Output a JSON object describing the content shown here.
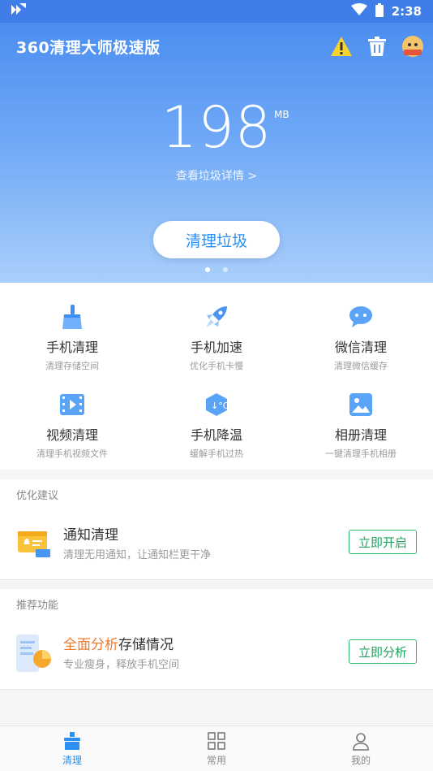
{
  "status": {
    "time": "2:38"
  },
  "header": {
    "title": "360清理大师极速版"
  },
  "hero": {
    "amount": "198",
    "unit": "MB",
    "detail_link": "查看垃圾详情 >",
    "clean_button": "清理垃圾",
    "page_dots": 2,
    "active_dot": 1
  },
  "grid": [
    {
      "title": "手机清理",
      "sub": "清理存储空间",
      "icon": "broom-icon"
    },
    {
      "title": "手机加速",
      "sub": "优化手机卡慢",
      "icon": "rocket-icon"
    },
    {
      "title": "微信清理",
      "sub": "清理微信缓存",
      "icon": "chat-bubble-icon"
    },
    {
      "title": "视频清理",
      "sub": "清理手机视频文件",
      "icon": "video-icon"
    },
    {
      "title": "手机降温",
      "sub": "缓解手机过热",
      "icon": "thermometer-celsius-icon"
    },
    {
      "title": "相册清理",
      "sub": "一键清理手机相册",
      "icon": "photo-icon"
    }
  ],
  "suggestions": {
    "label": "优化建议",
    "card": {
      "title": "通知清理",
      "sub": "清理无用通知，让通知栏更干净",
      "button": "立即开启"
    }
  },
  "recommend": {
    "label": "推荐功能",
    "card": {
      "title_highlight": "全面分析",
      "title_rest": "存储情况",
      "sub": "专业瘦身，释放手机空间",
      "button": "立即分析"
    }
  },
  "nav": [
    {
      "label": "清理",
      "active": true
    },
    {
      "label": "常用",
      "active": false
    },
    {
      "label": "我的",
      "active": false
    }
  ],
  "colors": {
    "brand_blue": "#3f7ee8",
    "accent_green": "#2fb86e",
    "highlight_orange": "#f07a2a"
  }
}
